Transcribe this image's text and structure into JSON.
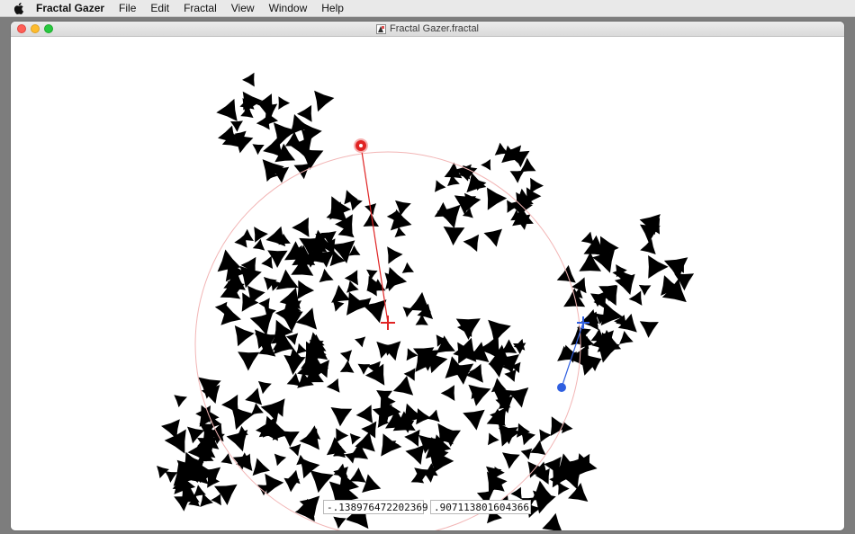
{
  "menubar": {
    "apple_icon": "apple-icon",
    "app_name": "Fractal Gazer",
    "items": [
      "File",
      "Edit",
      "Fractal",
      "View",
      "Window",
      "Help"
    ]
  },
  "window": {
    "title": "Fractal Gazer.fractal",
    "doc_icon": "document-icon"
  },
  "coordinates": {
    "x_value": "-.138976472202369",
    "y_value": ".907113801604366"
  },
  "colors": {
    "control_red": "#e02424",
    "control_blue": "#2f5fe0",
    "circle": "#f2b5b5"
  }
}
